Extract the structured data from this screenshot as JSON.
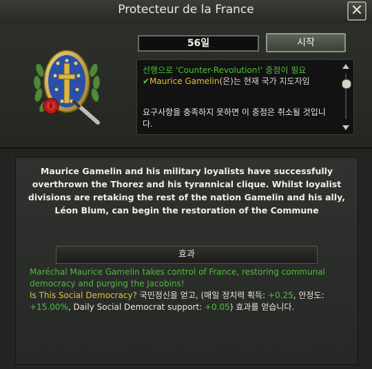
{
  "window": {
    "title": "Protecteur de la France",
    "close_glyph": "✕"
  },
  "focus": {
    "days": "56일",
    "start_label": "시작",
    "requirements": {
      "prereq": "선행으로 'Counter-Revolution!' 중점이 필요",
      "check_icon": "✔",
      "leader_name": "Maurice Gamelin",
      "leader_suffix": "(은)는 현재 국가 지도자임",
      "bypass": "요구사항을 충족하지 못하면 이 중점은 취소될 것입니다."
    },
    "description": "Maurice Gamelin and his military loyalists have successfully overthrown the Thorez and his tyrannical clique. Whilst loyalist divisions are retaking the rest of the nation Gamelin and his ally, Léon Blum, can begin the restoration of the Commune",
    "effects_header": "효과",
    "effects": {
      "line1": "Maréchal Maurice Gamelin takes control of France, restoring communal democracy and purging the Jacobins!",
      "idea_name": "Is This Social Democracy?",
      "idea_text_a": " 국민정신을 얻고, (매일 정치력 획득: ",
      "pp_value": "+0.25",
      "idea_text_b": ", 안정도: ",
      "stability_value": "+15.00%",
      "idea_text_c": ", Daily Social Democrat support: ",
      "support_value": "+0.05",
      "idea_text_d": ") 효과를 얻습니다."
    }
  },
  "colors": {
    "green": "#52b83e",
    "yellow": "#e0c43a",
    "text": "#e8e7df"
  },
  "icons": [
    "close-icon",
    "focus-emblem-icon",
    "check-icon",
    "scroll-up-icon",
    "scroll-down-icon"
  ]
}
